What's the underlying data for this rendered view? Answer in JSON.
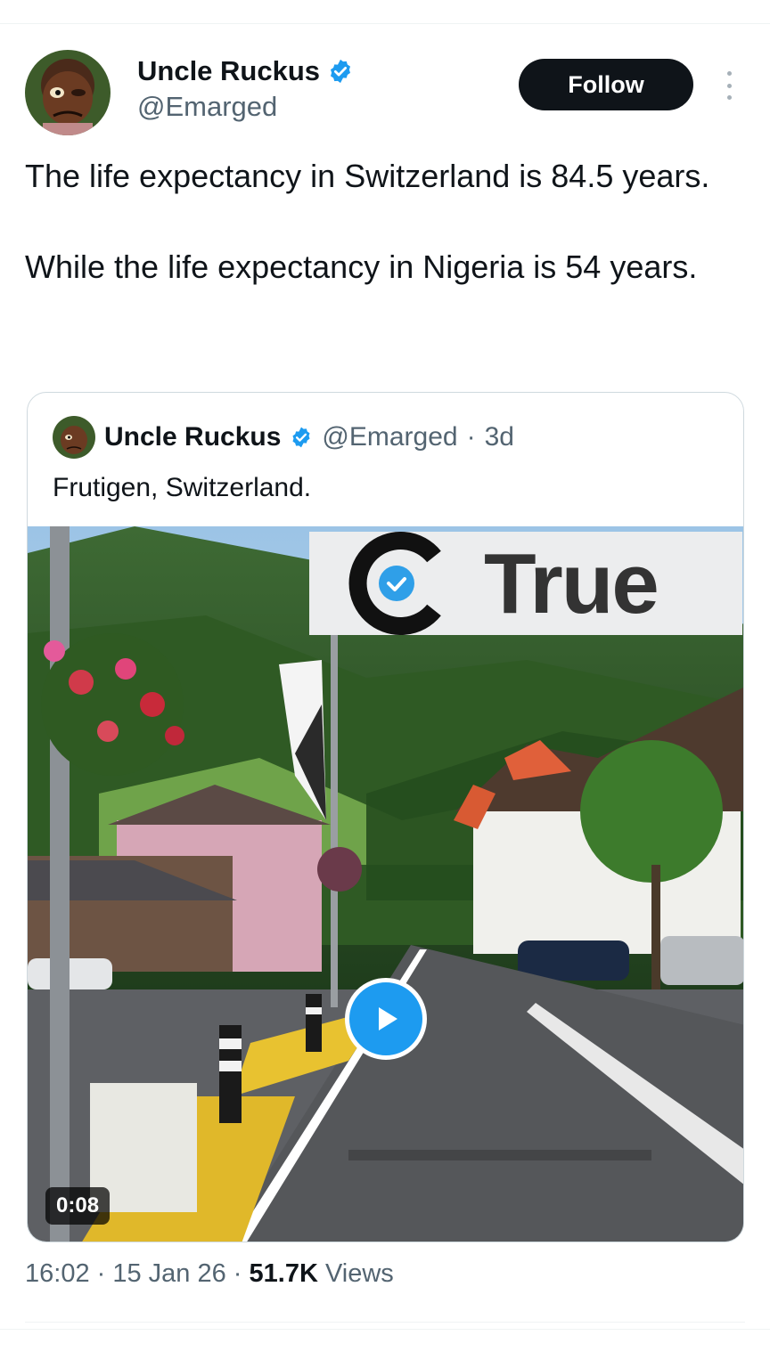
{
  "tweet": {
    "author": {
      "display_name": "Uncle Ruckus",
      "handle": "@Emarged",
      "verified_icon": "verified-badge-icon",
      "avatar_icon": "cartoon-avatar"
    },
    "follow_label": "Follow",
    "more_icon": "more-vertical-icon",
    "text_lines": [
      "The life expectancy in Switzerland is 84.5 years.",
      "While the life expectancy in Nigeria is 54 years."
    ],
    "meta": {
      "time": "16:02",
      "sep1": " · ",
      "date": "15 Jan 26",
      "sep2": " · ",
      "views_count": "51.7K",
      "views_label": " Views"
    }
  },
  "quoted_tweet": {
    "display_name": "Uncle Ruckus",
    "handle": "@Emarged",
    "sep": "·",
    "age": "3d",
    "text": "Frutigen, Switzerland.",
    "video": {
      "duration": "0:08",
      "watermark_text": "True",
      "play_icon": "play-icon"
    }
  },
  "colors": {
    "accent": "#1d9bf0",
    "text_primary": "#0f1419",
    "text_secondary": "#536471",
    "button_dark": "#0f1419",
    "border": "#cfd9de"
  }
}
